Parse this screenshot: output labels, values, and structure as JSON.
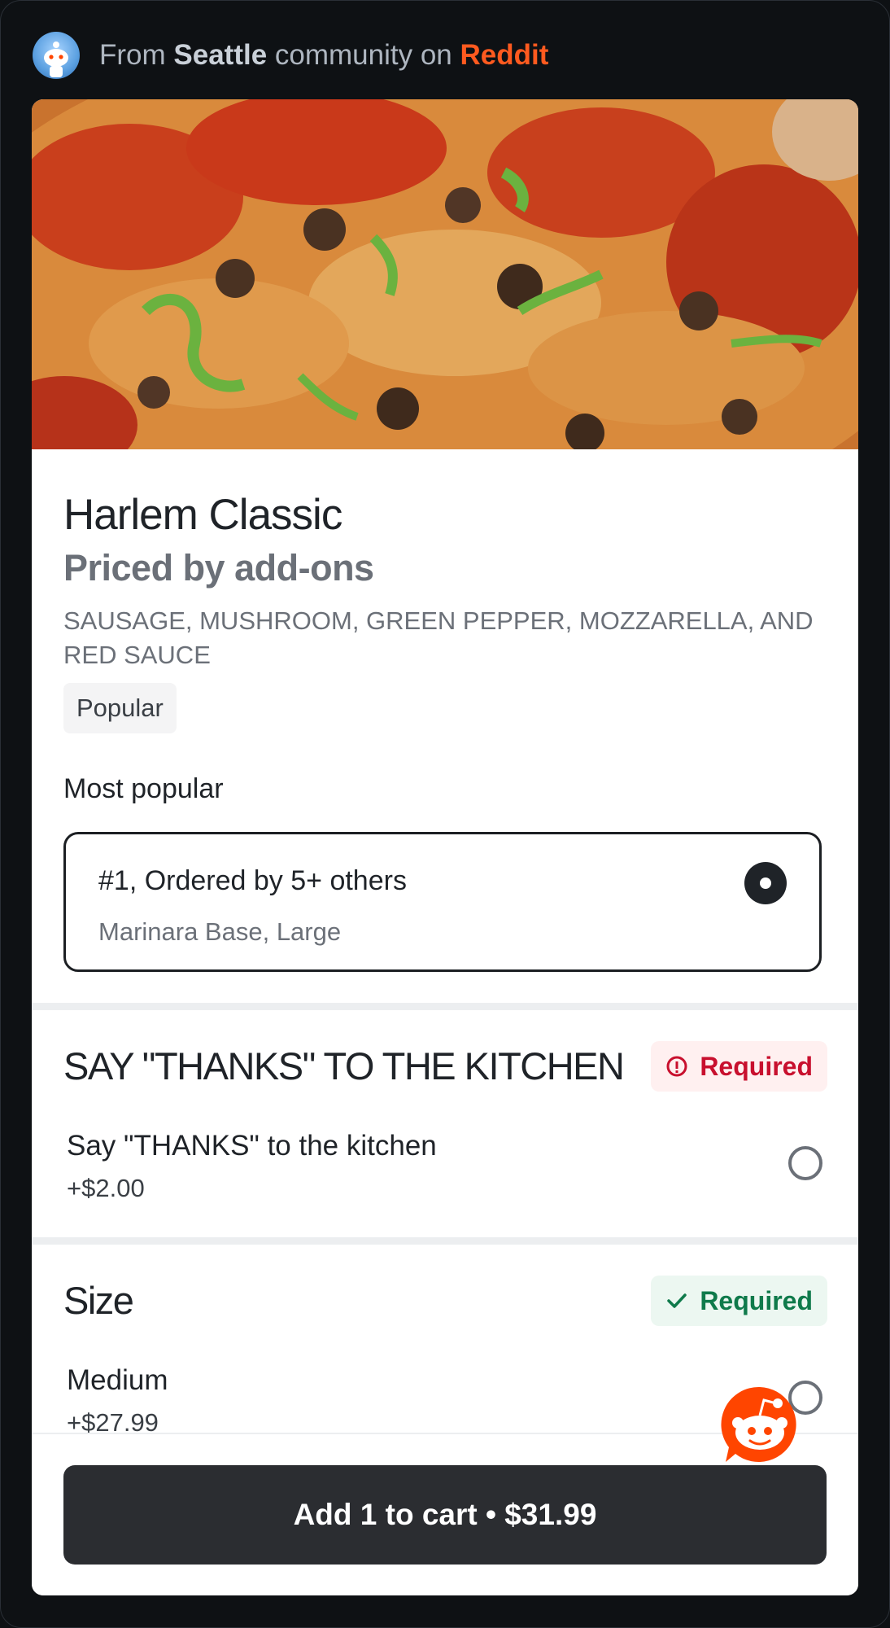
{
  "header": {
    "prefix": "From",
    "community": "Seattle",
    "middle": "community on",
    "platform": "Reddit",
    "avatar_icon": "reddit-snoo-avatar"
  },
  "item": {
    "title": "Harlem Classic",
    "subtitle": "Priced by add-ons",
    "description": "SAUSAGE, MUSHROOM, GREEN PEPPER, MOZZARELLA, AND RED SAUCE",
    "tag": "Popular"
  },
  "most_popular": {
    "label": "Most popular",
    "option_title": "#1, Ordered by 5+ others",
    "option_sub": "Marinara Base, Large",
    "selected": true
  },
  "sections": [
    {
      "title": "SAY \"THANKS\" TO THE KITCHEN",
      "badge": "Required",
      "badge_state": "error",
      "options": [
        {
          "label": "Say \"THANKS\" to the kitchen",
          "price": "+$2.00",
          "selected": false
        }
      ]
    },
    {
      "title": "Size",
      "badge": "Required",
      "badge_state": "satisfied",
      "options": [
        {
          "label": "Medium",
          "price": "+$27.99",
          "selected": false
        }
      ]
    }
  ],
  "cart": {
    "label": "Add 1 to cart • $31.99"
  },
  "colors": {
    "background": "#0e1114",
    "reddit_orange": "#ff5a1f",
    "button_dark": "#2b2d31",
    "required_red": "#c8102e",
    "required_green": "#0f7a4b"
  }
}
